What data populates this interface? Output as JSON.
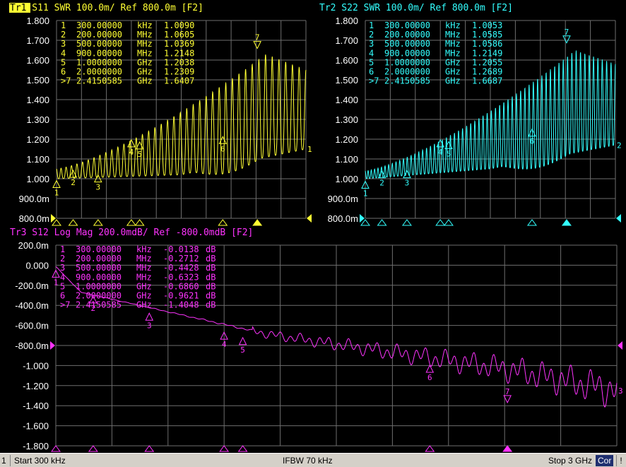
{
  "statusbar": {
    "channel": "1",
    "start": "Start 300 kHz",
    "ifbw": "IFBW 70 kHz",
    "stop": "Stop 3 GHz",
    "cor": "Cor",
    "warn": "!"
  },
  "colors": {
    "background": "#000000",
    "grid": "#6e6e6e",
    "tr1": "#ffff33",
    "tr2": "#33ffff",
    "tr3": "#ff33ff"
  },
  "chart_data": [
    {
      "type": "line",
      "trace": "Tr1",
      "title_parts": [
        "Tr1",
        " S11  SWR 100.0m/ Ref 800.0m [F2]"
      ],
      "x_range_hz": [
        300000,
        3000000000
      ],
      "ylim": [
        0.8,
        1.8
      ],
      "y_ticks": [
        "1.800",
        "1.700",
        "1.600",
        "1.500",
        "1.400",
        "1.300",
        "1.200",
        "1.100",
        "1.000",
        "900.0m",
        "800.0m"
      ],
      "ref_label": "800.0m",
      "color": "#ffff33",
      "markers": [
        {
          "id": "1",
          "freq": "300.00000",
          "unit": "kHz",
          "value": "1.0090",
          "x": 300000,
          "y": 1.009
        },
        {
          "id": "2",
          "freq": "200.00000",
          "unit": "MHz",
          "value": "1.0605",
          "x": 200000000,
          "y": 1.0605
        },
        {
          "id": "3",
          "freq": "500.00000",
          "unit": "MHz",
          "value": "1.0369",
          "x": 500000000,
          "y": 1.0369
        },
        {
          "id": "4",
          "freq": "900.00000",
          "unit": "MHz",
          "value": "1.2148",
          "x": 900000000,
          "y": 1.2148
        },
        {
          "id": "5",
          "freq": "1.0000000",
          "unit": "GHz",
          "value": "1.2038",
          "x": 1000000000,
          "y": 1.2038
        },
        {
          "id": "6",
          "freq": "2.0000000",
          "unit": "GHz",
          "value": "1.2309",
          "x": 2000000000,
          "y": 1.2309
        },
        {
          "id": ">7",
          "freq": "2.4150585",
          "unit": "GHz",
          "value": "1.6407",
          "x": 2415058500,
          "y": 1.6407
        }
      ],
      "trace_end_label": "1",
      "envelope": {
        "low_start": 1.0,
        "low_mid": 1.02,
        "low_end": 1.15,
        "high_start": 1.05,
        "high_peak": 1.63,
        "high_end": 1.55
      },
      "ripple_cycles": 40
    },
    {
      "type": "line",
      "trace": "Tr2",
      "title_parts": [
        "Tr2",
        " S22  SWR 100.0m/ Ref 800.0m [F2]"
      ],
      "x_range_hz": [
        300000,
        3000000000
      ],
      "ylim": [
        0.8,
        1.8
      ],
      "y_ticks": [
        "1.800",
        "1.700",
        "1.600",
        "1.500",
        "1.400",
        "1.300",
        "1.200",
        "1.100",
        "1.000",
        "900.0m",
        "800.0m"
      ],
      "ref_label": "800.0m",
      "color": "#33ffff",
      "markers": [
        {
          "id": "1",
          "freq": "300.00000",
          "unit": "kHz",
          "value": "1.0053",
          "x": 300000,
          "y": 1.0053
        },
        {
          "id": "2",
          "freq": "200.00000",
          "unit": "MHz",
          "value": "1.0585",
          "x": 200000000,
          "y": 1.0585
        },
        {
          "id": "3",
          "freq": "500.00000",
          "unit": "MHz",
          "value": "1.0586",
          "x": 500000000,
          "y": 1.0586
        },
        {
          "id": "4",
          "freq": "900.00000",
          "unit": "MHz",
          "value": "1.2149",
          "x": 900000000,
          "y": 1.2149
        },
        {
          "id": "5",
          "freq": "1.0000000",
          "unit": "GHz",
          "value": "1.2055",
          "x": 1000000000,
          "y": 1.2055
        },
        {
          "id": "6",
          "freq": "2.0000000",
          "unit": "GHz",
          "value": "1.2689",
          "x": 2000000000,
          "y": 1.2689
        },
        {
          "id": ">7",
          "freq": "2.4150585",
          "unit": "GHz",
          "value": "1.6687",
          "x": 2415058500,
          "y": 1.6687
        }
      ],
      "trace_end_label": "2",
      "envelope": {
        "low_start": 1.0,
        "low_mid": 1.05,
        "low_end": 1.17,
        "high_start": 1.04,
        "high_peak": 1.65,
        "high_end": 1.58
      },
      "ripple_cycles": 62
    },
    {
      "type": "line",
      "trace": "Tr3",
      "title_parts": [
        "Tr3",
        " S12  Log Mag 200.0mdB/ Ref -800.0mdB [F2]"
      ],
      "x_range_hz": [
        300000,
        3000000000
      ],
      "ylim": [
        -1.8,
        0.2
      ],
      "y_ticks": [
        "200.0m",
        "0.000",
        "-200.0m",
        "-400.0m",
        "-600.0m",
        "-800.0m",
        "-1.000",
        "-1.200",
        "-1.400",
        "-1.600",
        "-1.800"
      ],
      "ref_label": "-800.0m",
      "color": "#ff33ff",
      "markers": [
        {
          "id": "1",
          "freq": "300.00000",
          "unit": "kHz",
          "value": "-0.0138",
          "x": 300000,
          "y": -0.0138
        },
        {
          "id": "2",
          "freq": "200.00000",
          "unit": "MHz",
          "value": "-0.2712",
          "x": 200000000,
          "y": -0.2712
        },
        {
          "id": "3",
          "freq": "500.00000",
          "unit": "MHz",
          "value": "-0.4428",
          "x": 500000000,
          "y": -0.4428
        },
        {
          "id": "4",
          "freq": "900.00000",
          "unit": "MHz",
          "value": "-0.6323",
          "x": 900000000,
          "y": -0.6323
        },
        {
          "id": "5",
          "freq": "1.0000000",
          "unit": "GHz",
          "value": "-0.6860",
          "x": 1000000000,
          "y": -0.686
        },
        {
          "id": "6",
          "freq": "2.0000000",
          "unit": "GHz",
          "value": "-0.9621",
          "x": 2000000000,
          "y": -0.9621
        },
        {
          "id": ">7",
          "freq": "2.4150585",
          "unit": "GHz",
          "value": "-1.4048",
          "x": 2415058500,
          "y": -1.4048
        }
      ],
      "value_unit": "dB",
      "trace_end_label": "3"
    }
  ]
}
